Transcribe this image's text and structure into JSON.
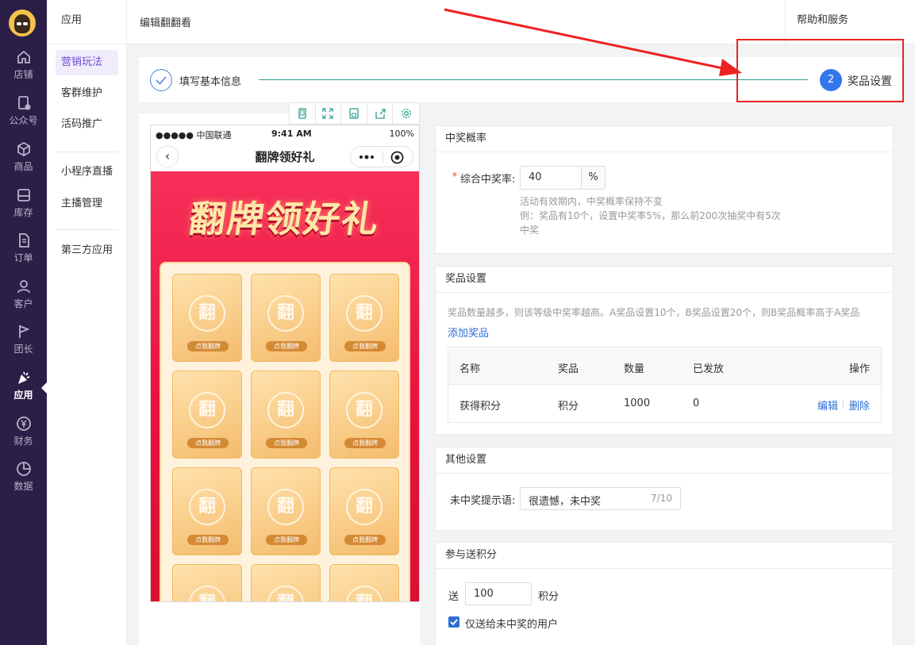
{
  "sidebar": {
    "items": [
      {
        "label": "店铺",
        "icon": "home-icon"
      },
      {
        "label": "公众号",
        "icon": "document-badge-icon"
      },
      {
        "label": "商品",
        "icon": "box-icon"
      },
      {
        "label": "库存",
        "icon": "inventory-icon"
      },
      {
        "label": "订单",
        "icon": "order-icon"
      },
      {
        "label": "客户",
        "icon": "users-icon"
      },
      {
        "label": "团长",
        "icon": "flag-icon"
      },
      {
        "label": "应用",
        "icon": "party-popper-icon"
      },
      {
        "label": "财务",
        "icon": "yen-icon"
      },
      {
        "label": "数据",
        "icon": "pie-chart-icon"
      }
    ],
    "active": "应用"
  },
  "submenu": {
    "header": "应用",
    "items": [
      "营销玩法",
      "客群维护",
      "活码推广",
      "小程序直播",
      "主播管理",
      "第三方应用"
    ],
    "active": "营销玩法"
  },
  "topbar": {
    "breadcrumb": "编辑翻翻看",
    "help": "帮助和服务"
  },
  "steps": {
    "step1": "填写基本信息",
    "step2_number": "2",
    "step2": "奖品设置"
  },
  "preview": {
    "tools": [
      "phone-icon",
      "fullscreen-icon",
      "save-icon",
      "share-icon",
      "settings-icon"
    ],
    "status_left": "●●●●● 中国联通",
    "status_time": "9:41 AM",
    "status_right": "100%",
    "nav_title": "翻牌领好礼",
    "back": "‹",
    "headline": "翻牌领好礼",
    "card_char": "翻",
    "card_button": "点我翻牌"
  },
  "probability": {
    "title": "中奖概率",
    "label": "综合中奖率:",
    "value": "40",
    "unit": "%",
    "hint1": "活动有效期内，中奖概率保持不变",
    "hint2": "例：奖品有10个，设置中奖率5%，那么前200次抽奖中有5次",
    "hint3": "中奖"
  },
  "prizes": {
    "title": "奖品设置",
    "hint": "奖品数量越多，则该等级中奖率越高。A奖品设置10个，B奖品设置20个，则B奖品概率高于A奖品",
    "add": "添加奖品",
    "columns": [
      "名称",
      "奖品",
      "数量",
      "已发放",
      "操作"
    ],
    "rows": [
      {
        "name": "获得积分",
        "prize": "积分",
        "qty": "1000",
        "issued": "0",
        "edit": "编辑",
        "delete": "删除"
      }
    ]
  },
  "other": {
    "title": "其他设置",
    "label": "未中奖提示语:",
    "value": "很遗憾，未中奖",
    "counter": "7/10"
  },
  "points": {
    "title": "参与送积分",
    "prefix": "送",
    "value": "100",
    "suffix": "积分",
    "checkbox_label": "仅送给未中奖的用户",
    "checked": true
  },
  "colors": {
    "sidebar": "#2b1f47",
    "accent": "#3377ee",
    "link": "#2e6fd6",
    "annotation": "#ee2222"
  }
}
